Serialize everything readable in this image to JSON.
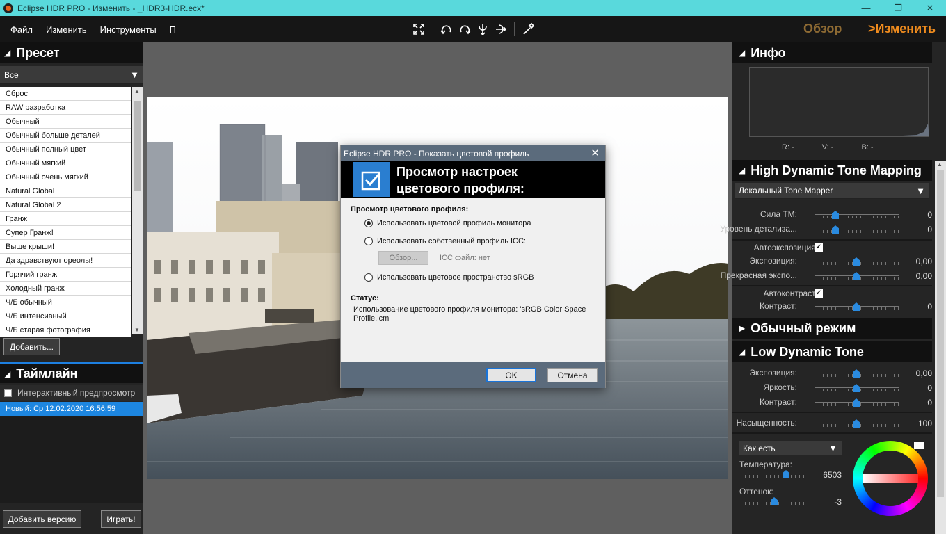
{
  "window": {
    "title": "Eclipse HDR PRO - Изменить - _HDR3-HDR.ecx*",
    "minimize": "—",
    "maximize": "❐",
    "close": "✕"
  },
  "menu": {
    "items": [
      "Файл",
      "Изменить",
      "Инструменты",
      "П"
    ]
  },
  "modes": {
    "overview": "Обзор",
    "edit": ">Изменить"
  },
  "left": {
    "preset_title": "Пресет",
    "filter": "Все",
    "presets": [
      "Сброс",
      "RAW разработка",
      "Обычный",
      "Обычный больше деталей",
      "Обычный полный цвет",
      "Обычный мягкий",
      "Обычный очень мягкий",
      "Natural Global",
      "Natural Global 2",
      "Гранж",
      "Супер Гранж!",
      "Выше крыши!",
      "Да здравствуют ореолы!",
      "Горячий гранж",
      "Холодный гранж",
      "Ч/Б обычный",
      "Ч/Б интенсивный",
      "Ч/Б старая фотография"
    ],
    "add_button": "Добавить...",
    "timeline_title": "Таймлайн",
    "interactive_preview": "Интерактивный предпросмотр",
    "timeline_item": "Новый: Ср 12.02.2020 16:56:59",
    "add_version_button": "Добавить версию",
    "play_button": "Играть!"
  },
  "dialog": {
    "title": "Eclipse HDR PRO - Показать цветовой профиль",
    "close": "✕",
    "heading": "Просмотр настроек цветового профиля:",
    "section_label": "Просмотр цветового профиля:",
    "option_monitor": "Использовать цветовой профиль монитора",
    "option_custom": "Использовать собственный профиль ICC:",
    "browse_button": "Обзор...",
    "icc_file": "ICC файл: нет",
    "option_srgb": "Использовать цветовое пространство sRGB",
    "status_label": "Статус:",
    "status_text": "Использование цветового профиля монитора: 'sRGB Color Space Profile.icm'",
    "ok": "OK",
    "cancel": "Отмена",
    "selected_option": "monitor"
  },
  "right": {
    "info_title": "Инфо",
    "r": "R: -",
    "v": "V: -",
    "b": "B: -",
    "hdr_title": "High Dynamic Tone Mapping",
    "tone_mapper": "Локальный Tone Mapper",
    "strength_label": "Сила ТМ:",
    "strength_value": "0",
    "detail_label": "Уровень детализа...",
    "detail_value": "0",
    "auto_exposure_label": "Автоэкспозиция:",
    "exposure_label": "Экспозиция:",
    "exposure_value": "0,00",
    "fine_exposure_label": "Прекрасная экспо...",
    "fine_exposure_value": "0,00",
    "auto_contrast_label": "Автоконтраст:",
    "contrast_label": "Контраст:",
    "contrast_value": "0",
    "normal_title": "Обычный режим",
    "ldr_title": "Low Dynamic Tone",
    "ldr_exposure_label": "Экспозиция:",
    "ldr_exposure_value": "0,00",
    "brightness_label": "Яркость:",
    "brightness_value": "0",
    "ldr_contrast_label": "Контраст:",
    "ldr_contrast_value": "0",
    "saturation_label": "Насыщенность:",
    "saturation_value": "100",
    "color_mode": "Как есть",
    "temperature_label": "Температура:",
    "temperature_value": "6503",
    "tint_label": "Оттенок:",
    "tint_value": "-3"
  },
  "colors": {
    "accent": "#1d86e0",
    "titlebar": "#59d9dc",
    "edit_mode": "#f08c1e"
  }
}
